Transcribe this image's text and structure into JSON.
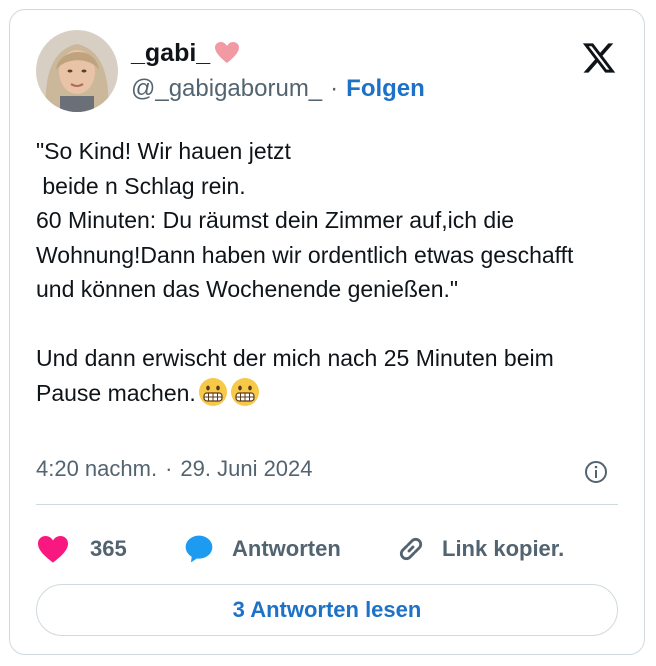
{
  "author": {
    "display_name": "_gabi_",
    "name_emoji": "pink-heart",
    "handle": "@_gabigaborum_",
    "separator": "·",
    "follow_label": "Folgen"
  },
  "tweet": {
    "text": "\"So Kind! Wir hauen jetzt\n beide n Schlag rein.\n60 Minuten: Du räumst dein Zimmer auf,ich die Wohnung!Dann haben wir ordentlich etwas geschafft und können das Wochenende genießen.\"\n\nUnd dann erwischt der mich nach 25 Minuten beim Pause machen.",
    "trailing_emoji": [
      "grimacing-face",
      "grimacing-face"
    ]
  },
  "meta": {
    "time": "4:20 nachm.",
    "separator": "·",
    "date": "29. Juni 2024"
  },
  "actions": {
    "like_count": "365",
    "reply_label": "Antworten",
    "copy_link_label": "Link kopier."
  },
  "read_replies_label": "3 Antworten lesen",
  "colors": {
    "like": "#f91880",
    "reply": "#1d9bf0",
    "link_blue": "#1d72c7",
    "secondary_text": "#536471",
    "border": "#cfd9de"
  }
}
